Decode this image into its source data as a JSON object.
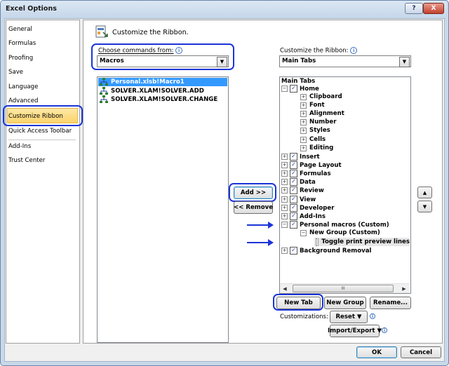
{
  "window": {
    "title": "Excel Options"
  },
  "titlebar_buttons": {
    "help": "?",
    "close": "X"
  },
  "nav": {
    "items": [
      {
        "label": "General"
      },
      {
        "label": "Formulas"
      },
      {
        "label": "Proofing"
      },
      {
        "label": "Save"
      },
      {
        "label": "Language"
      },
      {
        "label": "Advanced"
      },
      {
        "label": "Customize Ribbon",
        "selected": true
      },
      {
        "label": "Quick Access Toolbar"
      },
      {
        "label": "Add-Ins"
      },
      {
        "label": "Trust Center"
      }
    ]
  },
  "header": {
    "title": "Customize the Ribbon."
  },
  "commands": {
    "label": "Choose commands from:",
    "value": "Macros",
    "items": [
      {
        "label": "Personal.xlsb!Macro1",
        "selected": true
      },
      {
        "label": "SOLVER.XLAM!SOLVER.ADD"
      },
      {
        "label": "SOLVER.XLAM!SOLVER.CHANGE"
      }
    ]
  },
  "ribbon": {
    "label": "Customize the Ribbon:",
    "value": "Main Tabs",
    "list_header": "Main Tabs",
    "home": "Home",
    "home_groups": [
      "Clipboard",
      "Font",
      "Alignment",
      "Number",
      "Styles",
      "Cells",
      "Editing"
    ],
    "tabs": [
      "Insert",
      "Page Layout",
      "Formulas",
      "Data",
      "Review",
      "View",
      "Developer",
      "Add-Ins"
    ],
    "custom_tab": "Personal macros (Custom)",
    "custom_group": "New Group (Custom)",
    "custom_command": "Toggle print preview lines",
    "last_tab": "Background Removal",
    "scroll_thumb": "III"
  },
  "buttons": {
    "add": "Add >>",
    "remove": "<< Remove",
    "new_tab": "New Tab",
    "new_group": "New Group",
    "rename": "Rename...",
    "customizations_label": "Customizations:",
    "reset": "Reset ▼",
    "import_export": "Import/Export ▼",
    "ok": "OK",
    "cancel": "Cancel",
    "move_up": "▲",
    "move_down": "▼"
  },
  "colors": {
    "highlight_outline": "#1b35d8",
    "selected_nav": "#fbd36c",
    "list_selection": "#3399ff"
  }
}
